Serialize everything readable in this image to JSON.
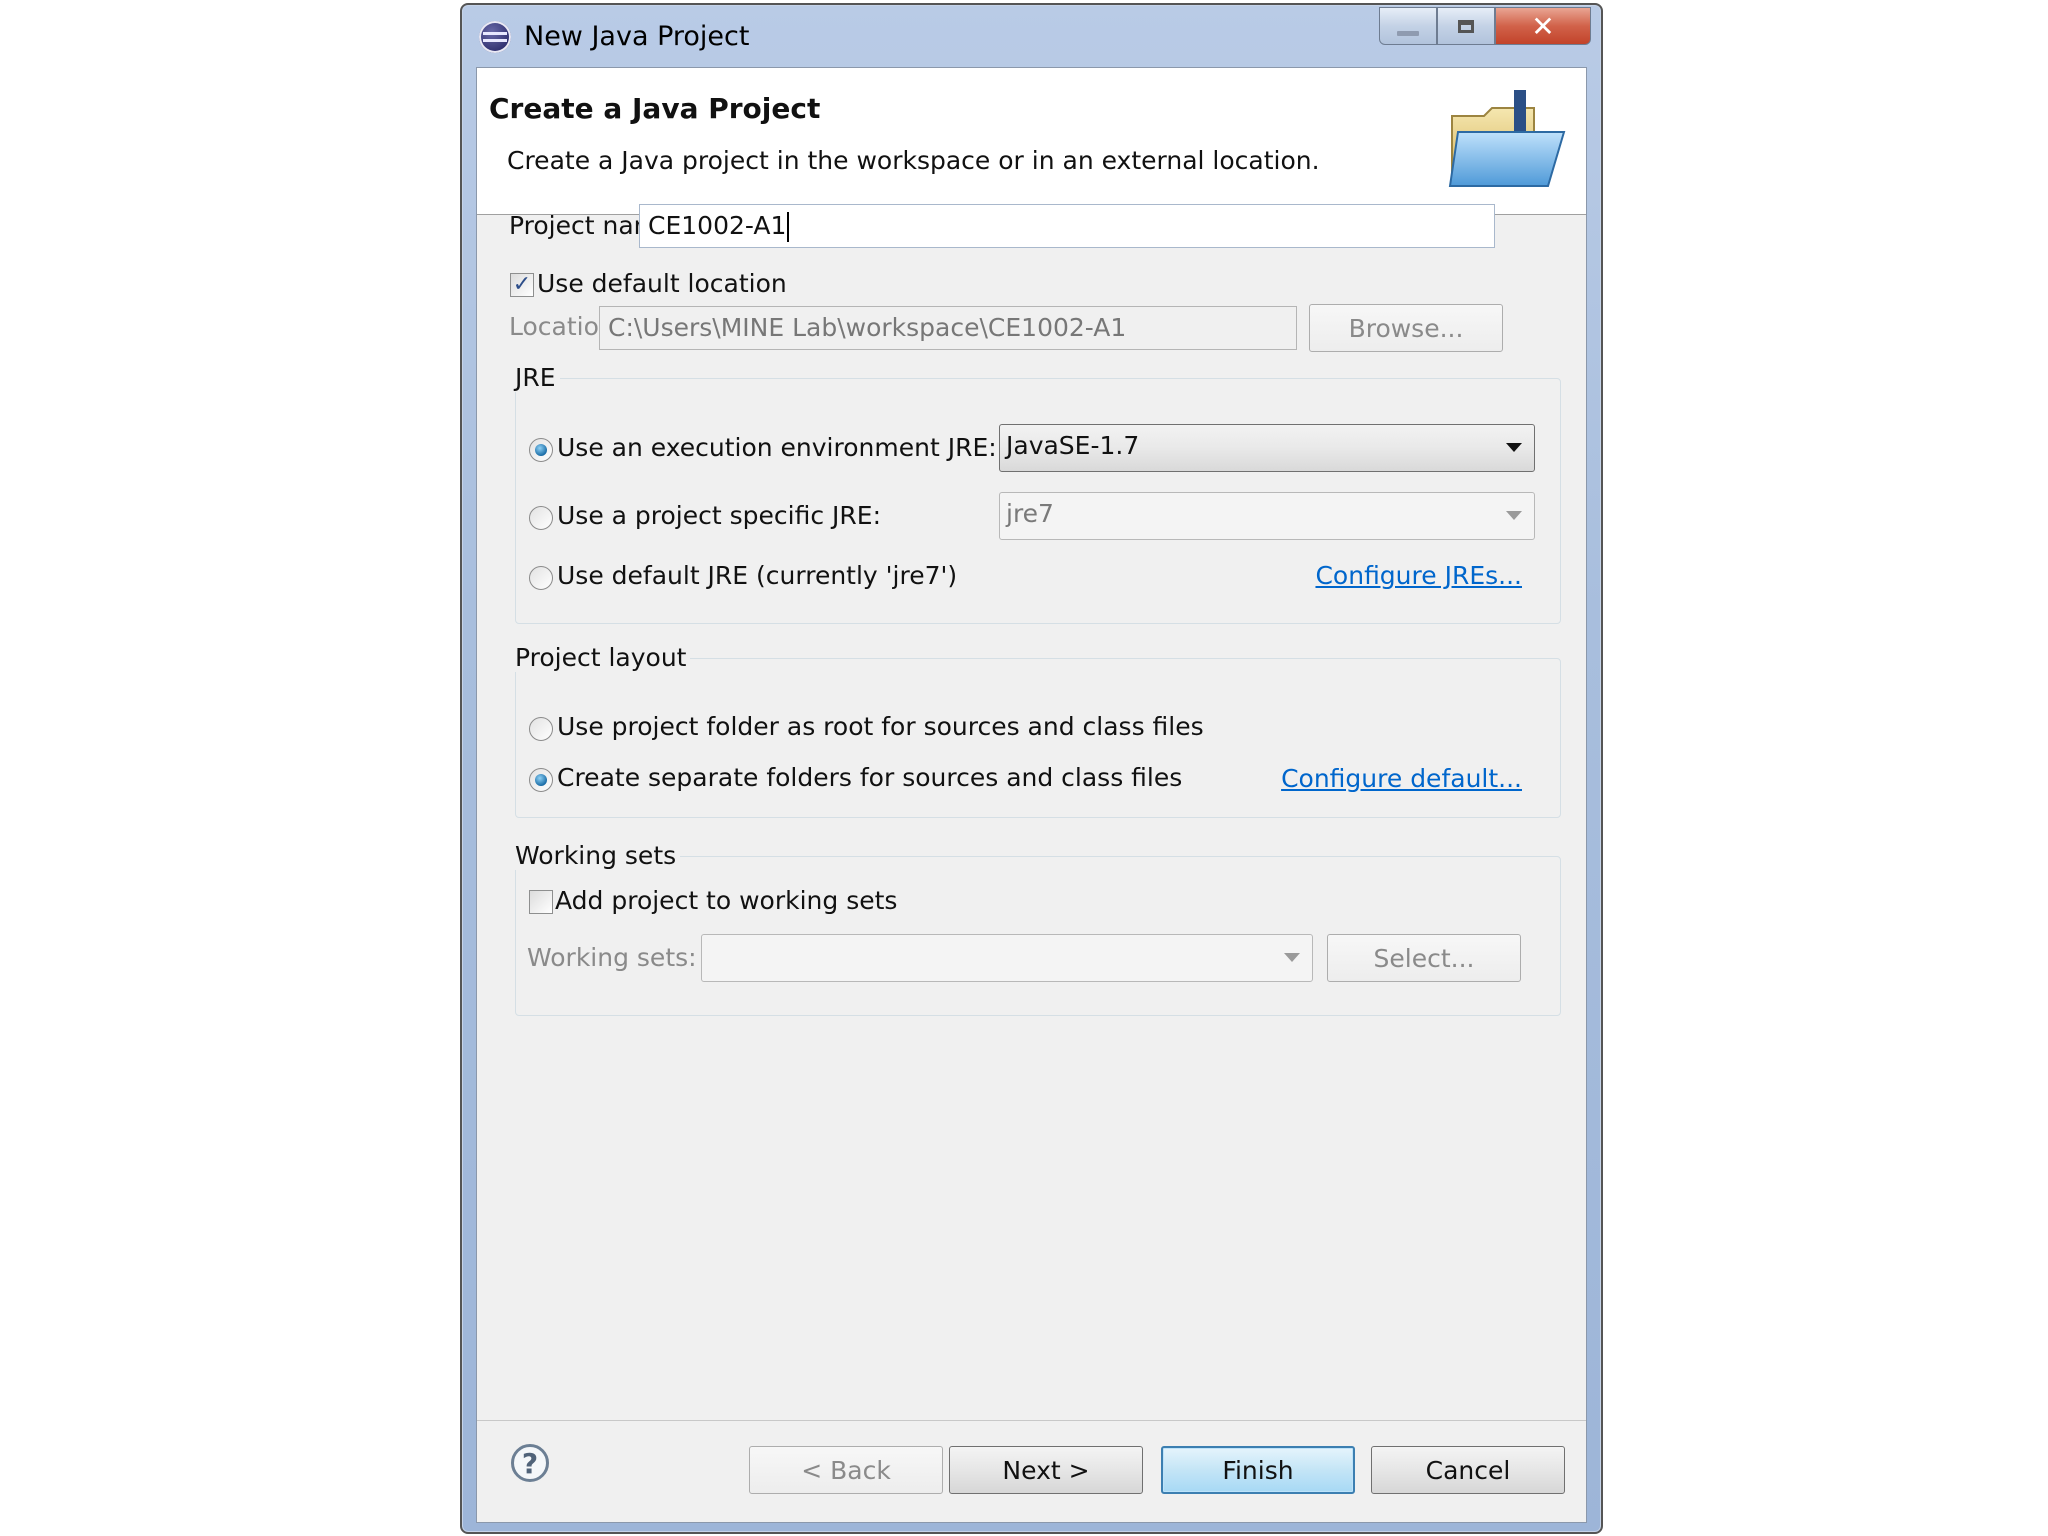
{
  "window": {
    "title": "New Java Project",
    "close_glyph": "✕"
  },
  "banner": {
    "title": "Create a Java Project",
    "description": "Create a Java project in the workspace or in an external location.",
    "image_icon": "java-project-folder-icon"
  },
  "project": {
    "name_label": "Project name:",
    "name_value": "CE1002-A1",
    "use_default_location_label": "Use default location",
    "use_default_location_checked": true,
    "location_label": "Location:",
    "location_value": "C:\\Users\\MINE Lab\\workspace\\CE1002-A1",
    "browse_label": "Browse..."
  },
  "jre": {
    "legend": "JRE",
    "exec_env_label": "Use an execution environment JRE:",
    "exec_env_value": "JavaSE-1.7",
    "project_specific_label": "Use a project specific JRE:",
    "project_specific_value": "jre7",
    "default_jre_label": "Use default JRE (currently 'jre7')",
    "configure_link": "Configure JREs...",
    "selected": "exec_env"
  },
  "layout": {
    "legend": "Project layout",
    "root_label": "Use project folder as root for sources and class files",
    "separate_label": "Create separate folders for sources and class files",
    "configure_link": "Configure default...",
    "selected": "separate"
  },
  "working_sets": {
    "legend": "Working sets",
    "add_label": "Add project to working sets",
    "add_checked": false,
    "sets_label": "Working sets:",
    "sets_value": "",
    "select_label": "Select..."
  },
  "footer": {
    "help_glyph": "?",
    "back_label": "< Back",
    "next_label": "Next >",
    "finish_label": "Finish",
    "cancel_label": "Cancel"
  },
  "colors": {
    "link": "#0066cc",
    "default_button_border": "#3c7fb1",
    "close_button": "#c2432a"
  }
}
